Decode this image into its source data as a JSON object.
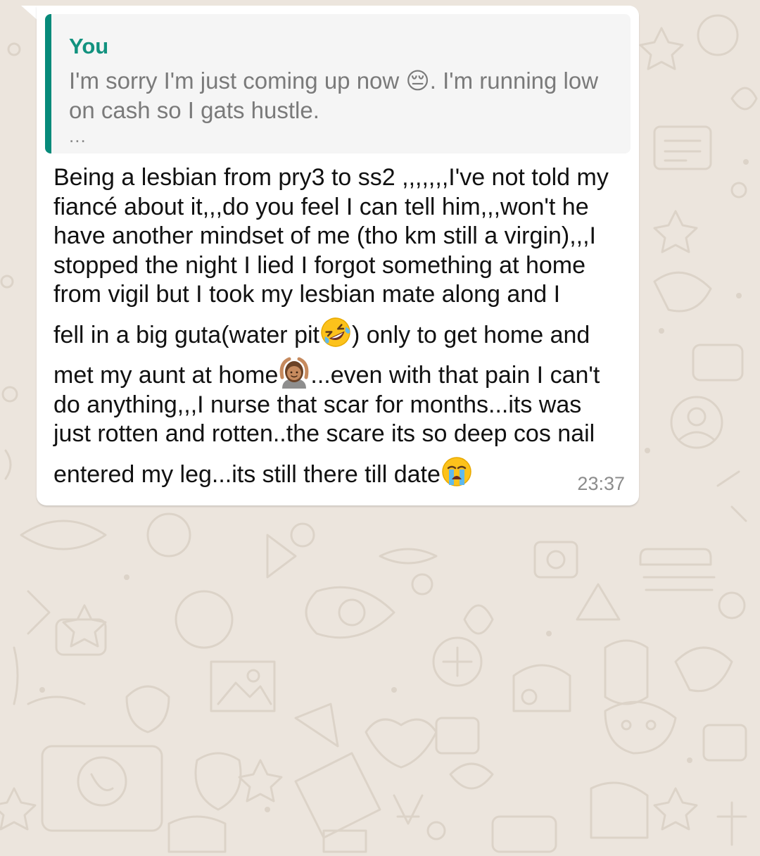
{
  "chat": {
    "message": {
      "quoted": {
        "author": "You",
        "text": "I'm sorry I'm just coming up now 😔. I'm running low on cash so I gats hustle.",
        "more": "..."
      },
      "lines": [
        "Being a lesbian from pry3 to ss2 ,,,,,,,I've not told my",
        "fiancé about it,,,do you feel I can tell him,,,won't he",
        "have another mindset of me (tho km still a virgin),,,I",
        "stopped the night I lied I forgot something at home",
        "from vigil but I took my lesbian mate along and I"
      ],
      "line6_before": "fell in a big guta(water pit",
      "line6_after": ") only to get home and",
      "line7_before": "met my aunt at home",
      "line7_after": "...even with that pain I can't",
      "lines_after": [
        "do anything,,,I nurse that scar for months...its was",
        "just rotten and rotten..the scare its so deep cos nail"
      ],
      "line10_before": "entered my leg...its still there till date",
      "time": "23:37",
      "emojis": {
        "quoted": "pensive-face",
        "line6": "rolling-on-floor-laughing",
        "line7": "person-gesturing-ok-medium-skin",
        "line10": "loudly-crying-face"
      }
    },
    "colors": {
      "wallpaper": "#ece5dd",
      "bubble": "#ffffff",
      "quote_bar": "#078a7a",
      "quote_author": "#12927f",
      "timestamp": "#8c8c8c"
    }
  }
}
